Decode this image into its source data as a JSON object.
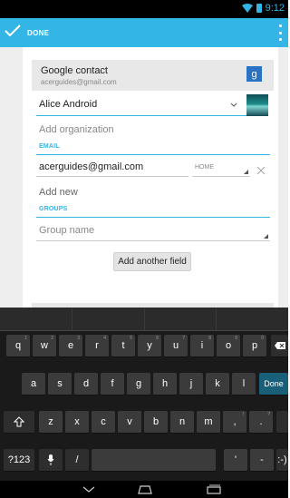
{
  "status_bar": {
    "time": "9:12",
    "icons": [
      "wifi-icon",
      "battery-icon"
    ],
    "accent": "#33b5e5"
  },
  "action_bar": {
    "done_label": "DONE",
    "done_icon": "checkmark-icon",
    "overflow_icon": "overflow-menu-icon",
    "color": "#33b5e5"
  },
  "account": {
    "type": "Google contact",
    "email": "acerguides@gmail.com",
    "icon": "google-plus-icon",
    "icon_glyph": "g"
  },
  "name": {
    "value": "Alice Android"
  },
  "organization": {
    "placeholder": "Add organization"
  },
  "email_section": {
    "label": "EMAIL",
    "value": "acerguides@gmail.com",
    "type": "HOME",
    "add_new": "Add new"
  },
  "groups_section": {
    "label": "GROUPS",
    "placeholder": "Group name"
  },
  "add_field_button": "Add another field",
  "keyboard": {
    "row1": [
      "q",
      "w",
      "e",
      "r",
      "t",
      "y",
      "u",
      "i",
      "o",
      "p"
    ],
    "row2": [
      "a",
      "s",
      "d",
      "f",
      "g",
      "h",
      "j",
      "k",
      "l"
    ],
    "row3": [
      "z",
      "x",
      "c",
      "v",
      "b",
      "n",
      "m",
      ",",
      "."
    ],
    "row1_hints": [
      "1",
      "2",
      "3",
      "4",
      "5",
      "6",
      "7",
      "8",
      "9",
      "0"
    ],
    "row3_hints": [
      "",
      "",
      "",
      "",
      "",
      "",
      "",
      "!",
      "?"
    ],
    "done_label": "Done",
    "symbols_label": "?123",
    "slash_label": "/",
    "apostrophe_label": "'",
    "dash_label": "-",
    "smiley_label": ":-)"
  },
  "nav_bar": {
    "back_icon": "back-icon",
    "home_icon": "home-icon",
    "recents_icon": "recents-icon"
  }
}
